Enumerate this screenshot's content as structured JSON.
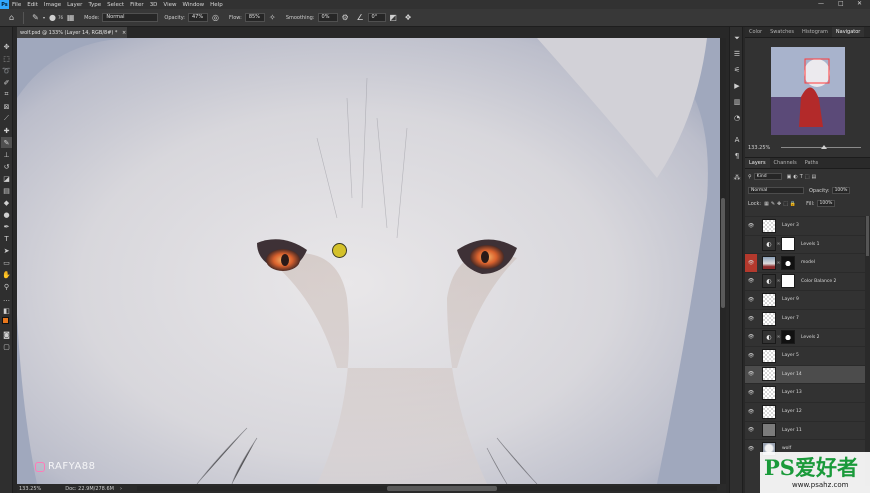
{
  "menu": {
    "app_icon": "Ps",
    "items": [
      "File",
      "Edit",
      "Image",
      "Layer",
      "Type",
      "Select",
      "Filter",
      "3D",
      "View",
      "Window",
      "Help"
    ],
    "window_controls": [
      "—",
      "□",
      "✕"
    ]
  },
  "options": {
    "mode_label": "Mode:",
    "mode_value": "Normal",
    "opacity_label": "Opacity:",
    "opacity_value": "47%",
    "flow_label": "Flow:",
    "flow_value": "85%",
    "smoothing_label": "Smoothing:",
    "smoothing_value": "0%",
    "angle_value": "0°",
    "brush_size": "76"
  },
  "document": {
    "tab_title": "wolf.psd @ 133% (Layer 14, RGB/8#) *",
    "tab_close": "×"
  },
  "status": {
    "zoom": "133.25%",
    "doc_info": "Doc: 22.9M/278.6M",
    "arrow": "›"
  },
  "navigator": {
    "tabs": [
      "Color",
      "Swatches",
      "Histogram",
      "Navigator"
    ],
    "active_tab": "Navigator",
    "zoom": "133.25%"
  },
  "layers": {
    "tabs": [
      "Layers",
      "Channels",
      "Paths"
    ],
    "active_tab": "Layers",
    "filter_kind": "Kind",
    "blend_mode": "Normal",
    "opacity_label": "Opacity:",
    "opacity_value": "100%",
    "lock_label": "Lock:",
    "fill_label": "Fill:",
    "fill_value": "100%",
    "items": [
      {
        "name": "Layer 3",
        "thumb": "empty",
        "mask": "",
        "visible": true
      },
      {
        "name": "Levels 1",
        "thumb": "adj",
        "mask": "mask",
        "visible": false
      },
      {
        "name": "model",
        "thumb": "photo",
        "mask": "mask-dark",
        "visible": true,
        "highlight": true
      },
      {
        "name": "Color Balance 2",
        "thumb": "adj",
        "mask": "mask",
        "visible": true
      },
      {
        "name": "Layer 9",
        "thumb": "empty",
        "mask": "",
        "visible": true
      },
      {
        "name": "Layer 7",
        "thumb": "empty",
        "mask": "",
        "visible": true
      },
      {
        "name": "Levels 2",
        "thumb": "adj",
        "mask": "mask-dark",
        "visible": true
      },
      {
        "name": "Layer 5",
        "thumb": "empty",
        "mask": "",
        "visible": true
      },
      {
        "name": "Layer 14",
        "thumb": "empty",
        "mask": "",
        "visible": true,
        "selected": true
      },
      {
        "name": "Layer 13",
        "thumb": "empty",
        "mask": "",
        "visible": true
      },
      {
        "name": "Layer 12",
        "thumb": "empty",
        "mask": "",
        "visible": true
      },
      {
        "name": "Layer 11",
        "thumb": "gray",
        "mask": "",
        "visible": true
      },
      {
        "name": "wolf",
        "thumb": "wolf",
        "mask": "",
        "visible": true
      }
    ]
  },
  "watermarks": {
    "left": "RAFYA88",
    "right_main": "PS爱好者",
    "right_url": "www.psahz.com"
  },
  "colors": {
    "accent": "#31a8ff",
    "highlight_red": "#b3392d",
    "cursor": "#d4c12a"
  }
}
